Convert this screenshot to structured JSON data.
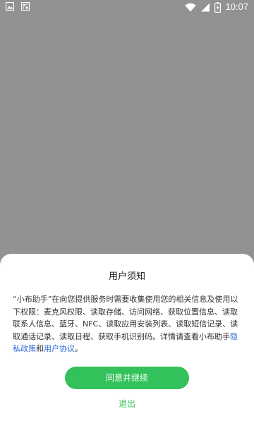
{
  "status_bar": {
    "time": "10:07",
    "left_icons": [
      "image-icon",
      "notification-icon"
    ],
    "right_icons": [
      "wifi-icon",
      "signal-icon",
      "battery-icon"
    ]
  },
  "dialog": {
    "title": "用户须知",
    "body_text": "“小布助手”在向您提供服务时需要收集使用您的相关信息及使用以下权限：麦克风权限、读取存储、访问网络、获取位置信息、读取联系人信息、蓝牙、NFC、读取应用安装列表、读取短信记录、读取通话记录、读取日程、获取手机识别码。详情请查看小布助手",
    "privacy_link": "隐私政策",
    "conjunction": "和",
    "agreement_link": "用户协议",
    "end_punctuation": "。",
    "agree_button": "同意并继续",
    "exit_link": "退出"
  },
  "colors": {
    "backdrop": "#929292",
    "primary_green": "#32c15a",
    "link_blue": "#2f6bd8"
  }
}
